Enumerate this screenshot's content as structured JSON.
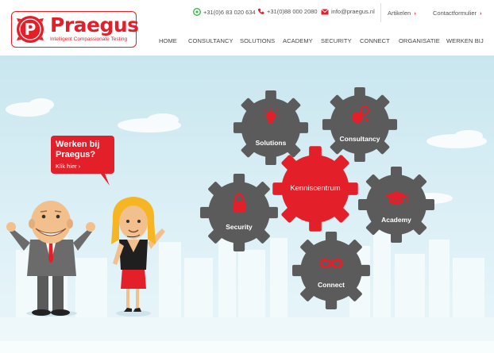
{
  "brand": {
    "name": "Praegus",
    "tagline": "Intelligent Compassionate Testing",
    "badge_letter": "P"
  },
  "contact": {
    "whatsapp": "+31(0)6 83 020 634",
    "phone": "+31(0)88 000 2080",
    "email": "info@praegus.nl"
  },
  "toplinks": {
    "articles": "Artikelen",
    "contact_form": "Contactformulier",
    "chevron": "›"
  },
  "nav": [
    "HOME",
    "CONSULTANCY",
    "SOLUTIONS",
    "ACADEMY",
    "SECURITY",
    "CONNECT",
    "ORGANISATIE",
    "WERKEN BIJ"
  ],
  "cta": {
    "title_line1": "Werken bij",
    "title_line2": "Praegus?",
    "sub": "Klik hier ›"
  },
  "gears": {
    "solutions": "Solutions",
    "consultancy": "Consultancy",
    "kenniscentrum": "Kenniscentrum",
    "security": "Security",
    "academy": "Academy",
    "connect": "Connect"
  },
  "colors": {
    "brand_red": "#e3202a",
    "gear_grey": "#5b5b5b",
    "sky": "#d5ecf3"
  }
}
